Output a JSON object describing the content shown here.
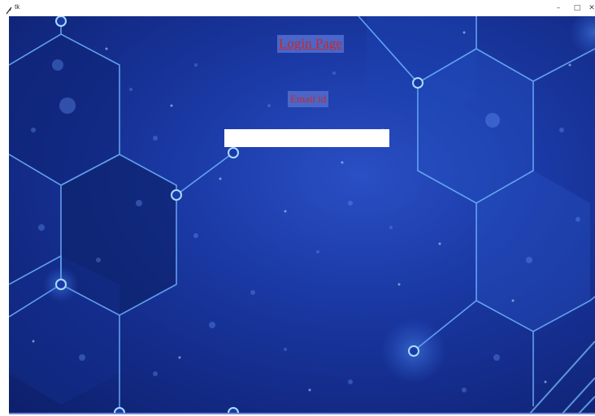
{
  "window": {
    "title": "tk",
    "minimize_glyph": "–",
    "maximize_glyph": "□",
    "close_glyph": "✕"
  },
  "login": {
    "heading": "Login Page",
    "email_label": "Email id",
    "email_value": "",
    "email_placeholder": ""
  },
  "colors": {
    "background_blue": "#1b3aa6",
    "label_background": "#4a66c8",
    "label_text": "#c8282d",
    "hex_line": "#6fb4ff"
  },
  "icons": {
    "app_icon": "feather-icon"
  }
}
